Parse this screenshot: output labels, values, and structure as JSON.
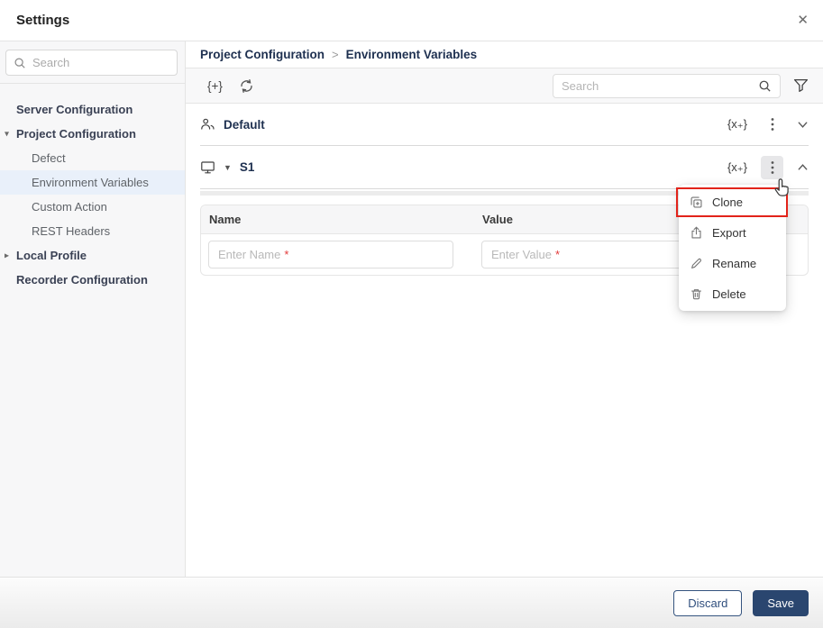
{
  "window": {
    "title": "Settings",
    "close_icon": "✕"
  },
  "sidebar": {
    "search_placeholder": "Search",
    "items": [
      {
        "label": "Server Configuration",
        "type": "group"
      },
      {
        "label": "Project Configuration",
        "type": "group",
        "caret": "▾"
      },
      {
        "label": "Defect",
        "type": "child"
      },
      {
        "label": "Environment Variables",
        "type": "child",
        "selected": true
      },
      {
        "label": "Custom Action",
        "type": "child"
      },
      {
        "label": "REST Headers",
        "type": "child"
      },
      {
        "label": "Local Profile",
        "type": "group",
        "caret": "▸"
      },
      {
        "label": "Recorder Configuration",
        "type": "group"
      }
    ]
  },
  "main": {
    "breadcrumb": {
      "items": [
        "Project Configuration",
        "Environment Variables"
      ],
      "separator": ">"
    },
    "toolbar": {
      "add_variables_label": "{+}",
      "search_placeholder": "Search"
    },
    "sections": {
      "default": {
        "name": "Default",
        "add_icon_label": "{x₊}"
      },
      "s1": {
        "name": "S1",
        "add_icon_label": "{x₊}"
      }
    },
    "table": {
      "columns": [
        "Name",
        "Value"
      ],
      "inputs": {
        "name_placeholder": "Enter Name",
        "value_placeholder": "Enter Value",
        "required_marker": "*"
      }
    },
    "context_menu": {
      "items": [
        {
          "label": "Clone",
          "highlighted": true
        },
        {
          "label": "Export"
        },
        {
          "label": "Rename"
        },
        {
          "label": "Delete"
        }
      ]
    }
  },
  "footer": {
    "discard_label": "Discard",
    "save_label": "Save"
  },
  "colors": {
    "accent_navy": "#2a466f",
    "breadcrumb_navy": "#1e3050",
    "selected_bg": "#e9f0fa",
    "annotation_red": "#e2231a"
  }
}
